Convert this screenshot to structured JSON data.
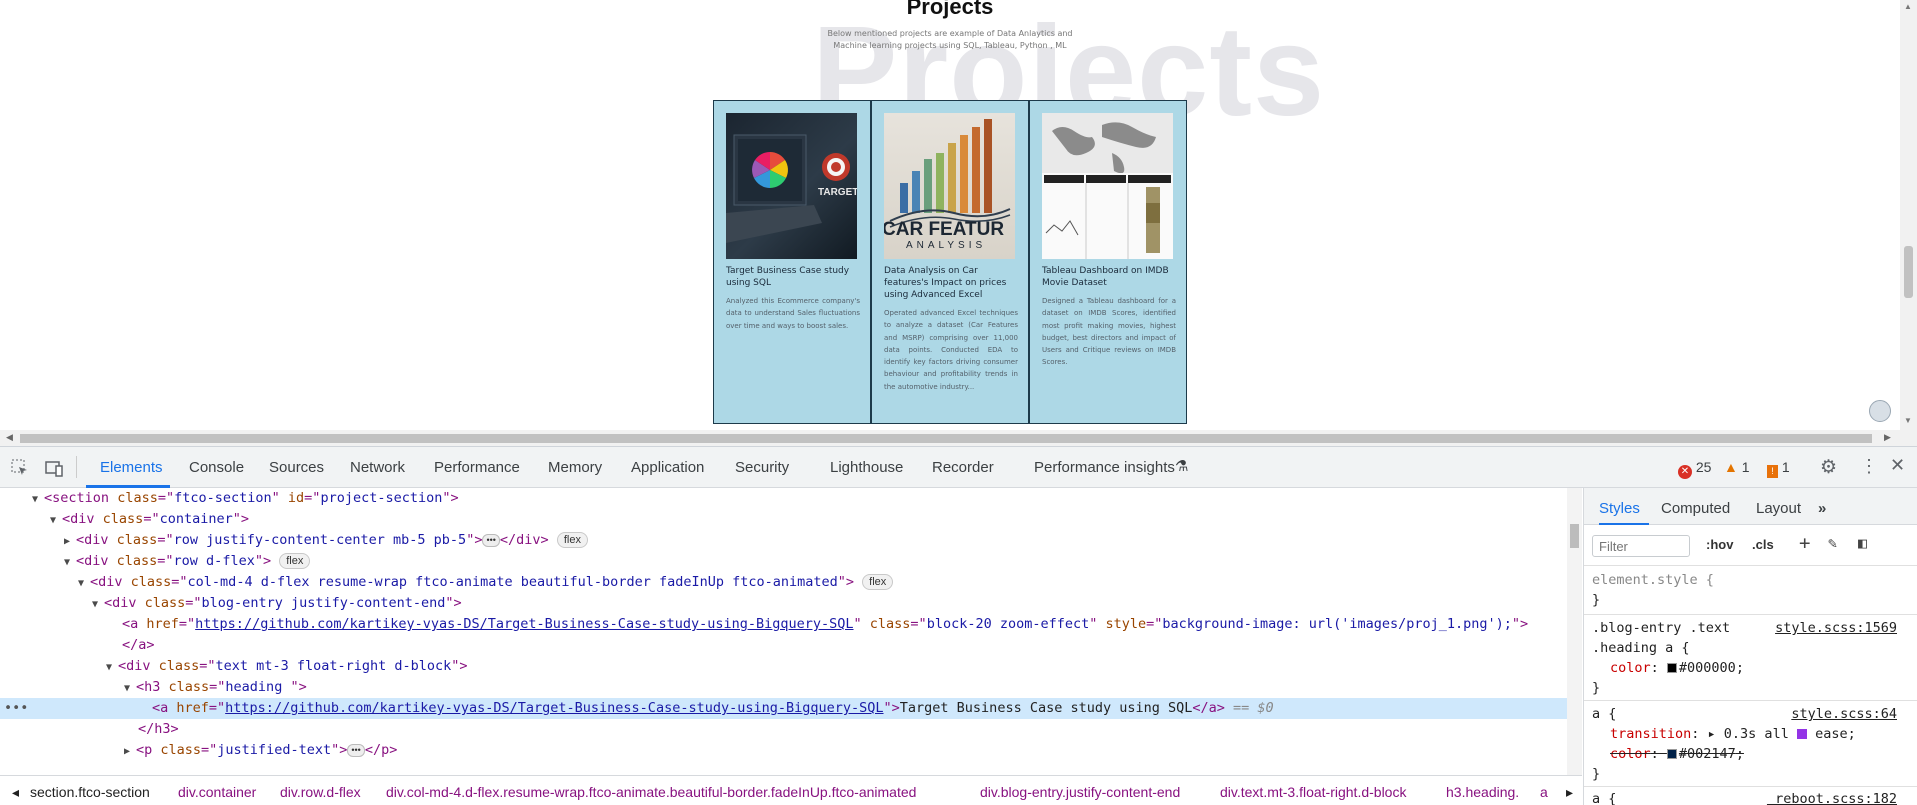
{
  "page": {
    "heading": "Projects",
    "watermark": "Projects",
    "subtitle": "Below mentioned projects are example of Data Anlaytics and Machine learning projects using SQL, Tableau, Python , ML",
    "cards": [
      {
        "title": "Target Business Case study using SQL",
        "desc": "Analyzed this Ecommerce company's data to understand Sales fluctuations over time and ways to boost sales.",
        "image_text": "TARGET"
      },
      {
        "title": "Data Analysis on Car features's Impact on prices using Advanced Excel",
        "desc": "Operated advanced Excel techniques to analyze a dataset (Car Features and MSRP) comprising over 11,000 data points. Conducted EDA to identify key factors driving consumer behaviour and profitability trends in the automotive industry...",
        "image_text_1": "CAR FEATUR",
        "image_text_2": "ANALYSIS"
      },
      {
        "title": "Tableau Dashboard on IMDB Movie Dataset",
        "desc": "Designed a Tableau dashboard for a dataset on IMDB Scores, identified most profit making movies, highest budget, best directors and impact of Users and Critique reviews on IMDB Scores."
      }
    ]
  },
  "devtools": {
    "tabs": [
      "Elements",
      "Console",
      "Sources",
      "Network",
      "Performance",
      "Memory",
      "Application",
      "Security",
      "Lighthouse",
      "Recorder",
      "Performance insights"
    ],
    "active_tab": "Elements",
    "errors": "25",
    "warnings": "1",
    "issues": "1",
    "dom": {
      "l1_tag": "section",
      "l1_class": "ftco-section",
      "l1_id": "project-section",
      "l2_tag": "div",
      "l2_class": "container",
      "l3_tag": "div",
      "l3_class": "row justify-content-center mb-5 pb-5",
      "l4_class": "row d-flex",
      "l5_class": "col-md-4 d-flex resume-wrap ftco-animate beautiful-border fadeInUp ftco-animated",
      "l6_class": "blog-entry justify-content-end",
      "href": "https://github.com/kartikey-vyas-DS/Target-Business-Case-study-using-Bigquery-SQL",
      "l7_class": "block-20 zoom-effect",
      "l7_style": "background-image: url('images/proj_1.png');",
      "l9_class": "text mt-3 float-right d-block",
      "l10_class": "heading ",
      "link_text": "Target Business Case study using SQL",
      "p_class": "justified-text",
      "flex_pill": "flex",
      "sel_marker": "== $0"
    },
    "breadcrumbs": [
      "section.ftco-section",
      "div.container",
      "div.row.d-flex",
      "div.col-md-4.d-flex.resume-wrap.ftco-animate.beautiful-border.fadeInUp.ftco-animated",
      "div.blog-entry.justify-content-end",
      "div.text.mt-3.float-right.d-block",
      "h3.heading.",
      "a"
    ],
    "styles": {
      "tabs": [
        "Styles",
        "Computed",
        "Layout"
      ],
      "filter_placeholder": "Filter",
      "hov": ":hov",
      "cls": ".cls",
      "element_style": "element.style {",
      "rule1_selector_1": ".blog-entry .text",
      "rule1_selector_2": ".heading a {",
      "rule1_source": "style.scss:1569",
      "rule1_prop": "color",
      "rule1_value": "#000000",
      "rule2_selector": "a {",
      "rule2_source": "style.scss:64",
      "rule2_prop1": "transition",
      "rule2_val1": "0.3s all",
      "rule2_val1b": "ease",
      "rule2_prop2": "color",
      "rule2_val2": "#002147",
      "rule3_selector": "a {",
      "rule3_source": "_reboot.scss:182",
      "close_brace": "}"
    }
  }
}
